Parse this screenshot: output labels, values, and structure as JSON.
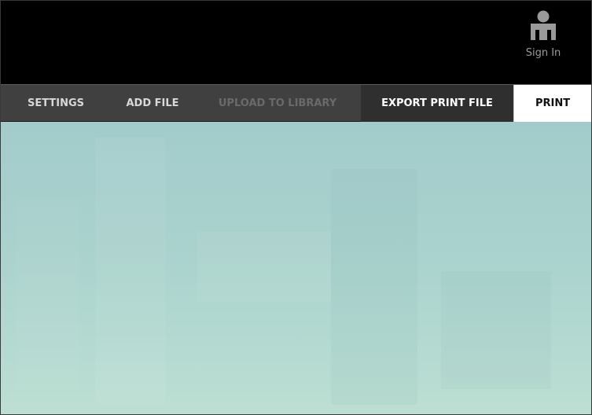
{
  "header": {
    "signin_label": "Sign In",
    "signin_icon": "user-icon",
    "signin_icon_color": "#9a9a9a"
  },
  "toolbar": {
    "settings_label": "SETTINGS",
    "add_file_label": "ADD FILE",
    "upload_label": "UPLOAD TO LIBRARY",
    "export_label": "EXPORT PRINT FILE",
    "print_label": "PRINT"
  },
  "colors": {
    "topbar_bg": "#000000",
    "toolbar_bg": "#404040",
    "export_bg": "#2f2f2f",
    "print_bg": "#ffffff",
    "disabled_text": "#6a6a6a",
    "canvas_tint": "#a9d1cd"
  }
}
